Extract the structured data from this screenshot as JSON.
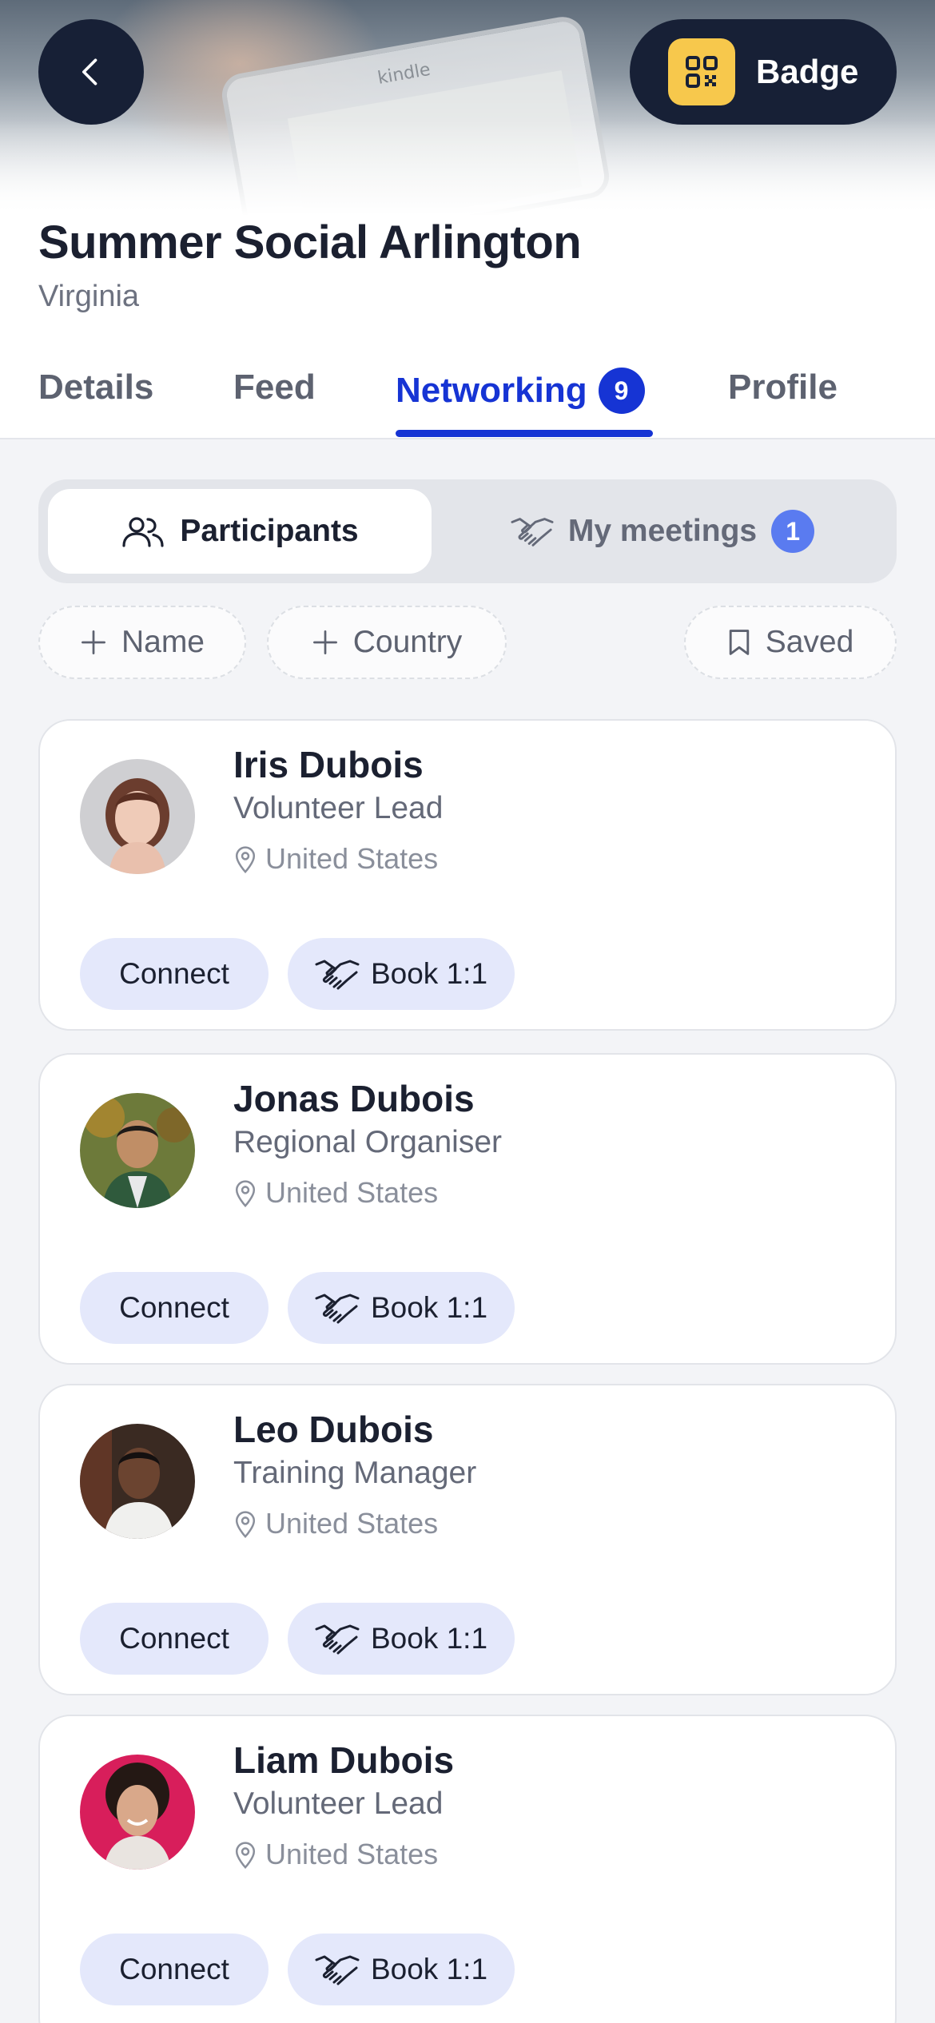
{
  "header": {
    "badge_label": "Badge",
    "event_title": "Summer Social Arlington",
    "event_location": "Virginia"
  },
  "tabs": [
    {
      "label": "Details"
    },
    {
      "label": "Feed"
    },
    {
      "label": "Networking",
      "count": "9",
      "active": true
    },
    {
      "label": "Profile"
    }
  ],
  "segmented": {
    "participants_label": "Participants",
    "meetings_label": "My meetings",
    "meetings_count": "1"
  },
  "filters": {
    "name_label": "Name",
    "country_label": "Country",
    "saved_label": "Saved"
  },
  "participants": [
    {
      "name": "Iris Dubois",
      "role": "Volunteer Lead",
      "location": "United States"
    },
    {
      "name": "Jonas Dubois",
      "role": "Regional Organiser",
      "location": "United States"
    },
    {
      "name": "Leo Dubois",
      "role": "Training Manager",
      "location": "United States"
    },
    {
      "name": "Liam Dubois",
      "role": "Volunteer Lead",
      "location": "United States"
    }
  ],
  "actions": {
    "connect_label": "Connect",
    "book_label": "Book 1:1"
  },
  "colors": {
    "accent": "#1634d4",
    "dark": "#172036",
    "badge_icon_bg": "#f7c84c",
    "pill_bg": "#e4e8fb"
  }
}
